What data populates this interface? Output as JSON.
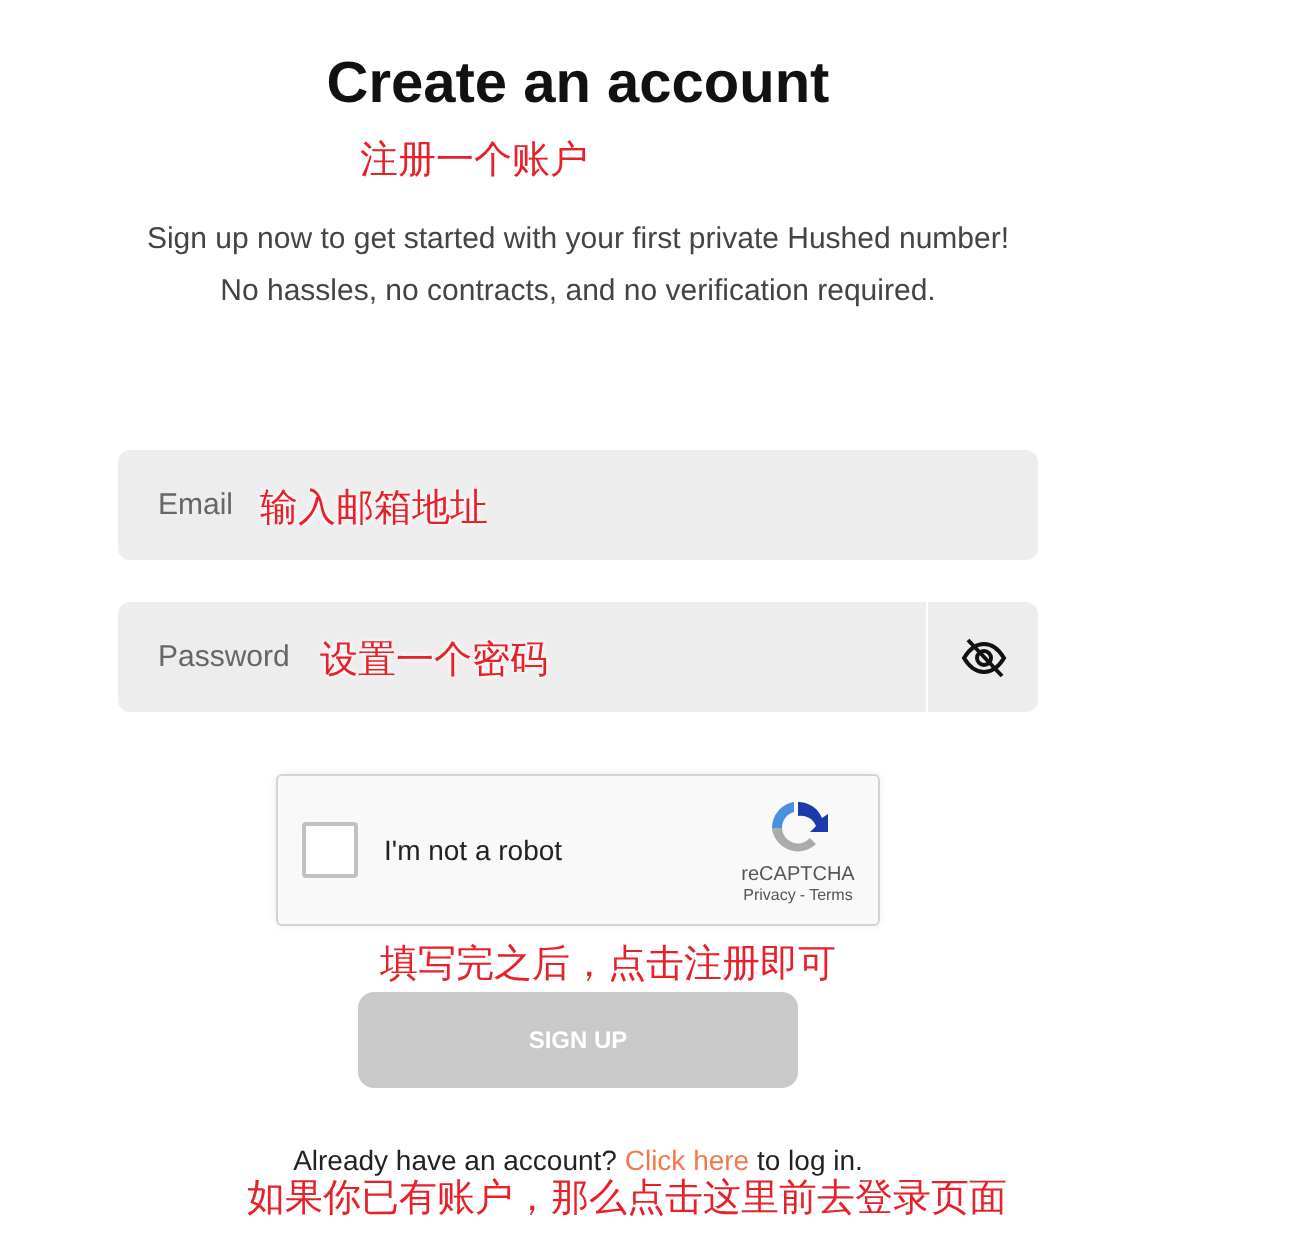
{
  "heading": "Create an account",
  "subtitle": [
    "Sign up now to get started with your first private Hushed number!",
    "No hassles, no contracts, and no verification required."
  ],
  "email_field": {
    "placeholder": "Email"
  },
  "password_field": {
    "placeholder": "Password"
  },
  "captcha": {
    "label": "I'm not a robot",
    "checked": false,
    "brand": "reCAPTCHA",
    "links": [
      "Privacy",
      "Terms"
    ],
    "separator": "-"
  },
  "sign_up_button": {
    "label": "SIGN UP",
    "disabled": true
  },
  "login_prompt": {
    "before": "Already have an account?",
    "link": "Click here",
    "after": "to log in."
  },
  "annotations": {
    "title": "注册一个账户",
    "email": "输入邮箱地址",
    "password": "设置一个密码",
    "submit": "填写完之后，点击注册即可",
    "login": "如果你已有账户，那么点击这里前去登录页面"
  }
}
